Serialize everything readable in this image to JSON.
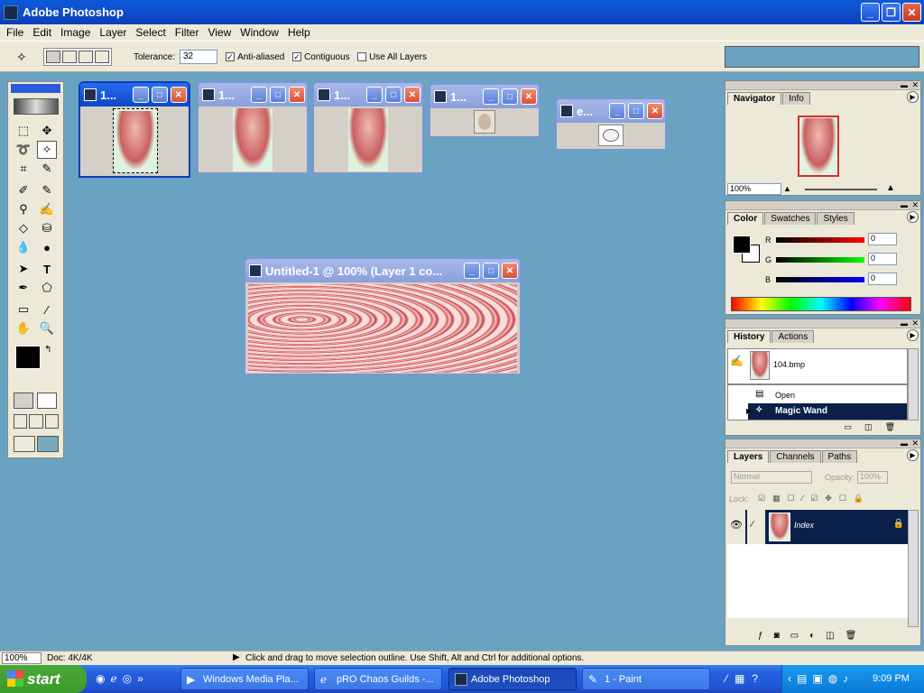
{
  "app": {
    "title": "Adobe Photoshop"
  },
  "menu": [
    "File",
    "Edit",
    "Image",
    "Layer",
    "Select",
    "Filter",
    "View",
    "Window",
    "Help"
  ],
  "options": {
    "tolerance_label": "Tolerance:",
    "tolerance_value": "32",
    "anti_aliased_label": "Anti-aliased",
    "anti_aliased_checked": true,
    "contiguous_label": "Contiguous",
    "contiguous_checked": true,
    "use_all_layers_label": "Use All Layers",
    "use_all_layers_checked": false
  },
  "documents": [
    {
      "title": "1...",
      "active": true
    },
    {
      "title": "1...",
      "active": false
    },
    {
      "title": "1...",
      "active": false
    },
    {
      "title": "1...",
      "active": false
    },
    {
      "title": "e...",
      "active": false
    },
    {
      "title": "Untitled-1 @ 100% (Layer 1 co...",
      "active": false
    }
  ],
  "navigator": {
    "tabs": [
      "Navigator",
      "Info"
    ],
    "zoom": "100%"
  },
  "color": {
    "tabs": [
      "Color",
      "Swatches",
      "Styles"
    ],
    "r_label": "R",
    "g_label": "G",
    "b_label": "B",
    "r": "0",
    "g": "0",
    "b": "0"
  },
  "history": {
    "tabs": [
      "History",
      "Actions"
    ],
    "snapshot": "104.bmp",
    "items": [
      "Open",
      "Magic Wand"
    ]
  },
  "layers": {
    "tabs": [
      "Layers",
      "Channels",
      "Paths"
    ],
    "blend_mode": "Normal",
    "opacity_label": "Opacity:",
    "opacity": "100%",
    "lock_label": "Lock:",
    "layer_name": "Index"
  },
  "status": {
    "zoom": "100%",
    "doc": "Doc: 4K/4K",
    "hint": "Click and drag to move selection outline.  Use Shift, Alt and Ctrl for additional options."
  },
  "taskbar": {
    "start": "start",
    "tasks": [
      "Windows Media Pla...",
      "pRO Chaos Guilds -...",
      "Adobe Photoshop",
      "1 - Paint"
    ],
    "clock": "9:09 PM"
  }
}
